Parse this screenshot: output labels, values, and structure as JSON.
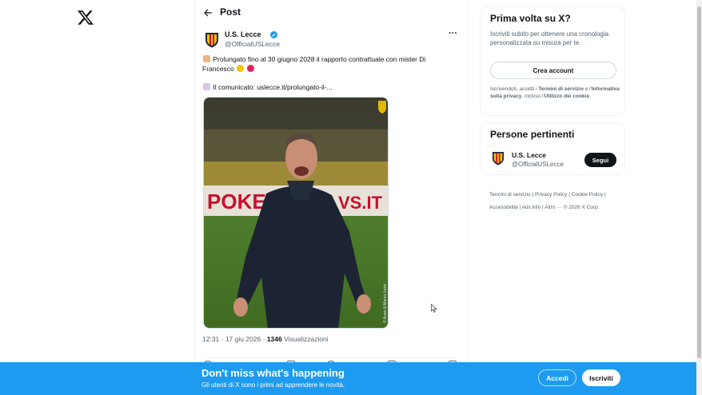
{
  "header": {
    "title": "Post"
  },
  "author": {
    "name": "U.S. Lecce",
    "handle": "@OfficialUSLecce"
  },
  "tweet": {
    "line1": "Prolungato fino al 30 giugno 2028 il rapporto contrattuale con mister Di",
    "line2": "Francesco",
    "line3_prefix": "Il comunicato: ",
    "link": "uslecce.it/prolungato-il-..."
  },
  "media": {
    "overlay_text_left": "POKE",
    "overlay_text_right": "VS.IT",
    "credit": "© Ansa & Marco Lezzi"
  },
  "meta": {
    "time": "12:31 · 17 giu 2026 · ",
    "views_count": "1346",
    "views_label": " Visualizzazioni"
  },
  "signup_card": {
    "title": "Prima volta su X?",
    "description": "Iscriviti subito per ottenere una cronologia personalizzata su misura per te.",
    "create_button": "Crea account",
    "legal_prefix": "Iscrivendoti, accetti i ",
    "legal_terms": "Termini di servizio",
    "legal_mid": " e l'",
    "legal_privacy": "Informativa sulla privacy",
    "legal_mid2": ", incluso l'",
    "legal_cookies": "Utilizzo dei cookie",
    "legal_end": "."
  },
  "people_card": {
    "title": "Persone pertinenti",
    "name": "U.S. Lecce",
    "handle": "@OfficialUSLecce",
    "follow_button": "Segui"
  },
  "footer": {
    "links_row1": "Termini di servizio | Privacy Policy | Cookie Policy |",
    "links_row2": "Accessibilità | Ads info | Altro ··· © 2026 X Corp."
  },
  "banner": {
    "title": "Don't miss what's happening",
    "subtitle": "Gli utenti di X sono i primi ad apprendere le novità.",
    "login_button": "Accedi",
    "signup_button": "Iscriviti"
  },
  "colors": {
    "accent": "#1d9bf0",
    "text": "#0f1419",
    "secondary": "#536471",
    "lecce_yellow": "#f5c400",
    "lecce_red": "#c8102e"
  }
}
